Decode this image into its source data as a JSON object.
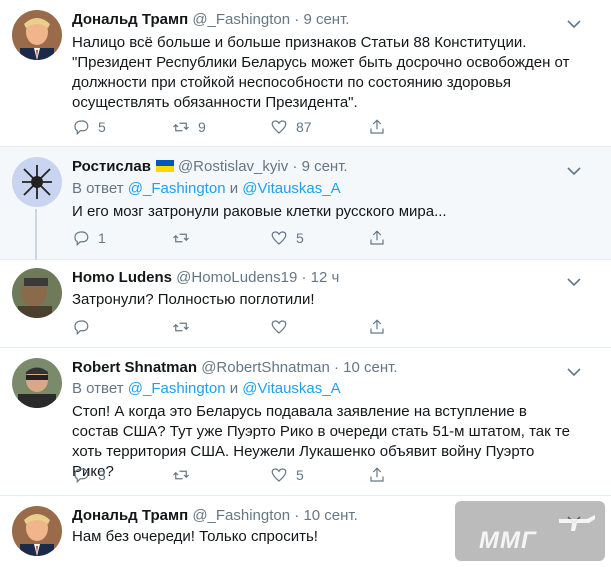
{
  "tweets": [
    {
      "name": "Дональд Трамп",
      "handle": "@_Fashington",
      "time": "9 сент.",
      "text": "Налицо всё больше и больше признаков Статьи 88 Конституции. \"Президент Республики Беларусь может быть досрочно освобожден от должности при стойкой неспособности по состоянию здоровья осуществлять обязанности Президента\".",
      "replies": "5",
      "retweets": "9",
      "likes": "87"
    },
    {
      "name": "Ростислав",
      "handle": "@Rostislav_kyiv",
      "time": "9 сент.",
      "flag": [
        "#0057b7",
        "#ffd700"
      ],
      "reply_prefix": "В ответ",
      "reply_user1": "@_Fashington",
      "reply_and": "и",
      "reply_user2": "@Vitauskas_A",
      "text": "И его мозг затронули раковые клетки русского мира...",
      "replies": "1",
      "retweets": "",
      "likes": "5"
    },
    {
      "name": "Homo Ludens",
      "handle": "@HomoLudens19",
      "time": "12 ч",
      "text": "Затронули? Полностью поглотили!",
      "replies": "",
      "retweets": "",
      "likes": ""
    },
    {
      "name": "Robert Shnatman",
      "handle": "@RobertShnatman",
      "time": "10 сент.",
      "reply_prefix": "В ответ",
      "reply_user1": "@_Fashington",
      "reply_and": "и",
      "reply_user2": "@Vitauskas_A",
      "text": "Стоп! А когда это Беларусь подавала заявление на вступление в состав США? Тут уже Пуэрто Рико в очереди стать 51-м штатом, так те хоть территория США. Неужели Лукашенко объявит войну Пуэрто Рико?",
      "replies": "3",
      "retweets": "",
      "likes": "5"
    },
    {
      "name": "Дональд Трамп",
      "handle": "@_Fashington",
      "time": "10 сент.",
      "text": "Нам без очереди! Только спросить!"
    }
  ],
  "separator": "·",
  "watermark": "ММГ",
  "colors": {
    "link": "#1da1f2",
    "muted": "#657786",
    "highlight_bg": "#f5f8fa",
    "thread_line": "#ccd6dd"
  }
}
